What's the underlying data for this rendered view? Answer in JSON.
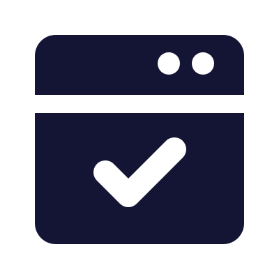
{
  "icon": {
    "name": "browser-window-check-icon",
    "colors": {
      "primary": "#141535",
      "foreground": "#ffffff",
      "background": "#ffffff"
    },
    "parts": [
      "window-frame",
      "window-control-dot",
      "window-control-dot",
      "header-divider",
      "checkmark-icon"
    ]
  }
}
